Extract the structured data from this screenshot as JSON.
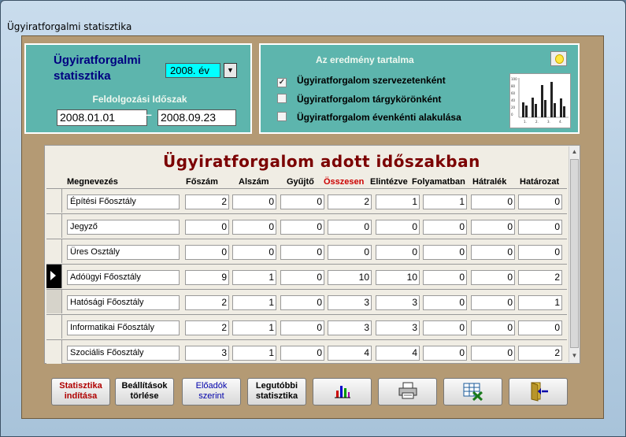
{
  "window": {
    "title": "Ügyiratforgalmi statisztika"
  },
  "header": {
    "app_title": "Ügyiratforgalmi\nstatisztika",
    "year_value": "2008. év",
    "period_label": "Feldolgozási Időszak",
    "date_from": "2008.01.01",
    "date_to": "2008.09.23",
    "dash": "–"
  },
  "results": {
    "title": "Az eredmény tartalma",
    "options": [
      {
        "label": "Ügyiratforgalom szervezetenként",
        "checked": true
      },
      {
        "label": "Ügyiratforgalom tárgykörönként",
        "checked": false
      },
      {
        "label": "Ügyiratforgalom évenkénti alakulása",
        "checked": false
      }
    ]
  },
  "grid": {
    "title": "Ügyiratforgalom adott időszakban",
    "columns": [
      "Megnevezés",
      "Főszám",
      "Alszám",
      "Gyűjtő",
      "Összesen",
      "Elintézve",
      "Folyamatban",
      "Hátralék",
      "Határozat"
    ],
    "rows": [
      {
        "name": "Építési Főosztály",
        "values": [
          "2",
          "0",
          "0",
          "2",
          "1",
          "1",
          "0",
          "0"
        ]
      },
      {
        "name": "Jegyző",
        "values": [
          "0",
          "0",
          "0",
          "0",
          "0",
          "0",
          "0",
          "0"
        ]
      },
      {
        "name": "Üres Osztály",
        "values": [
          "0",
          "0",
          "0",
          "0",
          "0",
          "0",
          "0",
          "0"
        ]
      },
      {
        "name": "Adóügyi Főosztály",
        "values": [
          "9",
          "1",
          "0",
          "10",
          "10",
          "0",
          "0",
          "2"
        ]
      },
      {
        "name": "Hatósági Főosztály",
        "values": [
          "2",
          "1",
          "0",
          "3",
          "3",
          "0",
          "0",
          "1"
        ]
      },
      {
        "name": "Informatikai Főosztály",
        "values": [
          "2",
          "1",
          "0",
          "3",
          "3",
          "0",
          "0",
          "0"
        ]
      },
      {
        "name": "Szociális Főosztály",
        "values": [
          "3",
          "1",
          "0",
          "4",
          "4",
          "0",
          "0",
          "2"
        ]
      }
    ]
  },
  "toolbar": {
    "start_line1": "Statisztika",
    "start_line2": "indítása",
    "clear_line1": "Beállítások",
    "clear_line2": "törlése",
    "speaker_line1": "Előadók",
    "speaker_line2": "szerint",
    "last_line1": "Legutóbbi",
    "last_line2": "statisztika"
  },
  "mini_chart": {
    "y_ticks": [
      "100",
      "80",
      "60",
      "40",
      "20",
      "0"
    ],
    "x_ticks": [
      "1.",
      "2.",
      "3.",
      "4."
    ]
  },
  "icons": [
    "bar-chart-icon",
    "printer-icon",
    "excel-export-icon",
    "exit-door-icon",
    "help-bulb-icon"
  ]
}
